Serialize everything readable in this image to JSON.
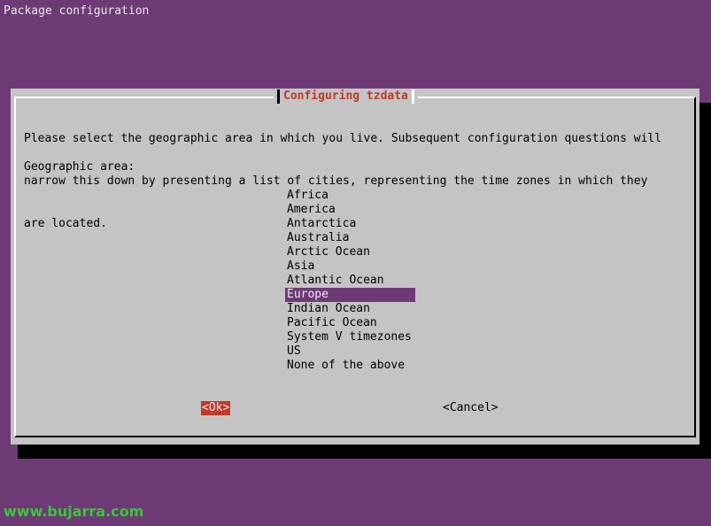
{
  "header": {
    "title": "Package configuration"
  },
  "dialog": {
    "title": "Configuring tzdata",
    "prompt_lines": [
      "Please select the geographic area in which you live. Subsequent configuration questions will",
      "narrow this down by presenting a list of cities, representing the time zones in which they",
      "are located."
    ],
    "area_label": "Geographic area:",
    "areas": [
      "Africa",
      "America",
      "Antarctica",
      "Australia",
      "Arctic Ocean",
      "Asia",
      "Atlantic Ocean",
      "Europe",
      "Indian Ocean",
      "Pacific Ocean",
      "System V timezones",
      "US",
      "None of the above"
    ],
    "selected_area": "Europe",
    "buttons": {
      "ok": "<Ok>",
      "cancel": "<Cancel>"
    }
  },
  "watermark": "www.bujarra.com",
  "colors": {
    "background": "#6e3a76",
    "dialog": "#c4c4c4",
    "title": "#c0392b",
    "ok_button": "#c0392b",
    "selection": "#6e3a76",
    "watermark": "#36c936"
  }
}
